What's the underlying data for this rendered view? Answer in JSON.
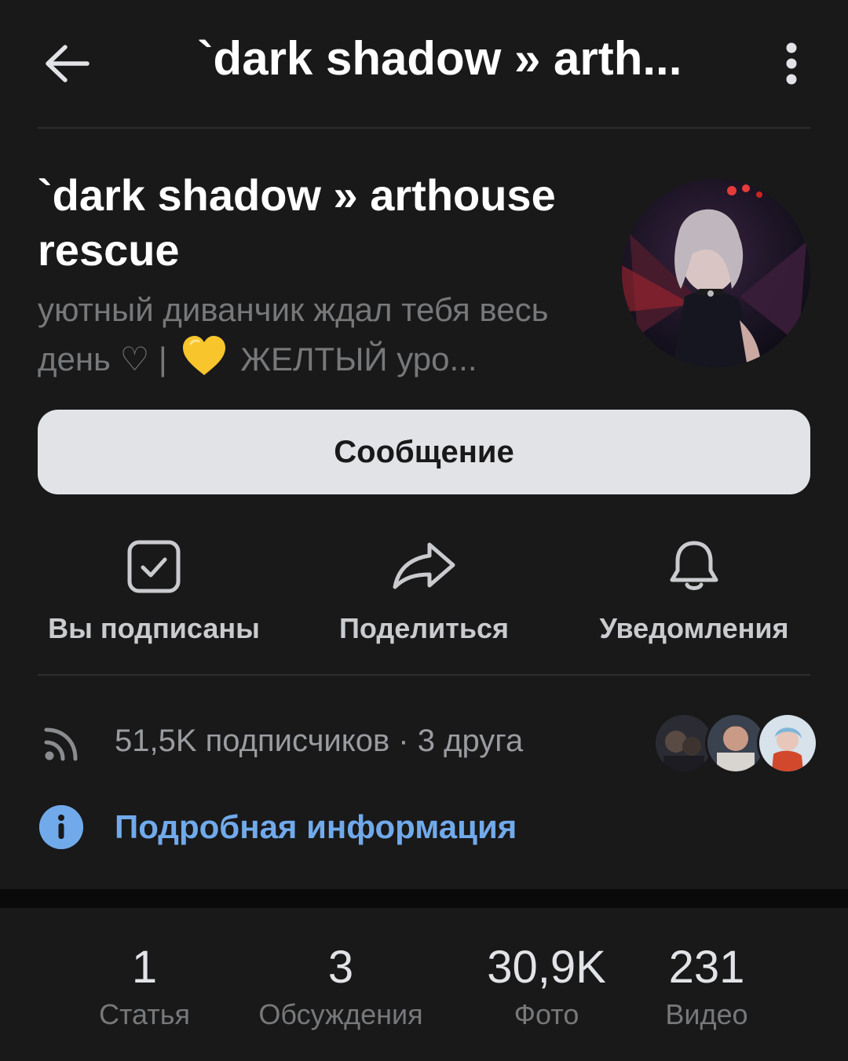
{
  "header": {
    "title": "`dark shadow »  arth...",
    "back_icon": "arrow-left-icon",
    "more_icon": "more-vertical-icon"
  },
  "profile": {
    "name": "`dark shadow »  arthouse rescue",
    "status_before": "уютный диванчик ждал тебя весь день ♡ |",
    "status_emoji": "yellow-heart-icon",
    "status_after": "ЖЕЛТЫЙ уро..."
  },
  "message_button": {
    "label": "Сообщение"
  },
  "actions": [
    {
      "label": "Вы подписаны",
      "icon": "checkbox-checked-icon"
    },
    {
      "label": "Поделиться",
      "icon": "share-arrow-icon"
    },
    {
      "label": "Уведомления",
      "icon": "bell-icon"
    }
  ],
  "followers": {
    "text": "51,5K подписчиков · 3 друга",
    "icon": "rss-icon"
  },
  "details": {
    "label": "Подробная информация",
    "icon": "info-icon"
  },
  "stats": [
    {
      "value": "1",
      "label": "Статья"
    },
    {
      "value": "3",
      "label": "Обсуждения"
    },
    {
      "value": "30,9K",
      "label": "Фото"
    },
    {
      "value": "231",
      "label": "Видео"
    }
  ],
  "colors": {
    "background": "#19191a",
    "accent": "#71aaeb",
    "button_bg": "#e1e3e6",
    "secondary_text": "#76787a"
  }
}
